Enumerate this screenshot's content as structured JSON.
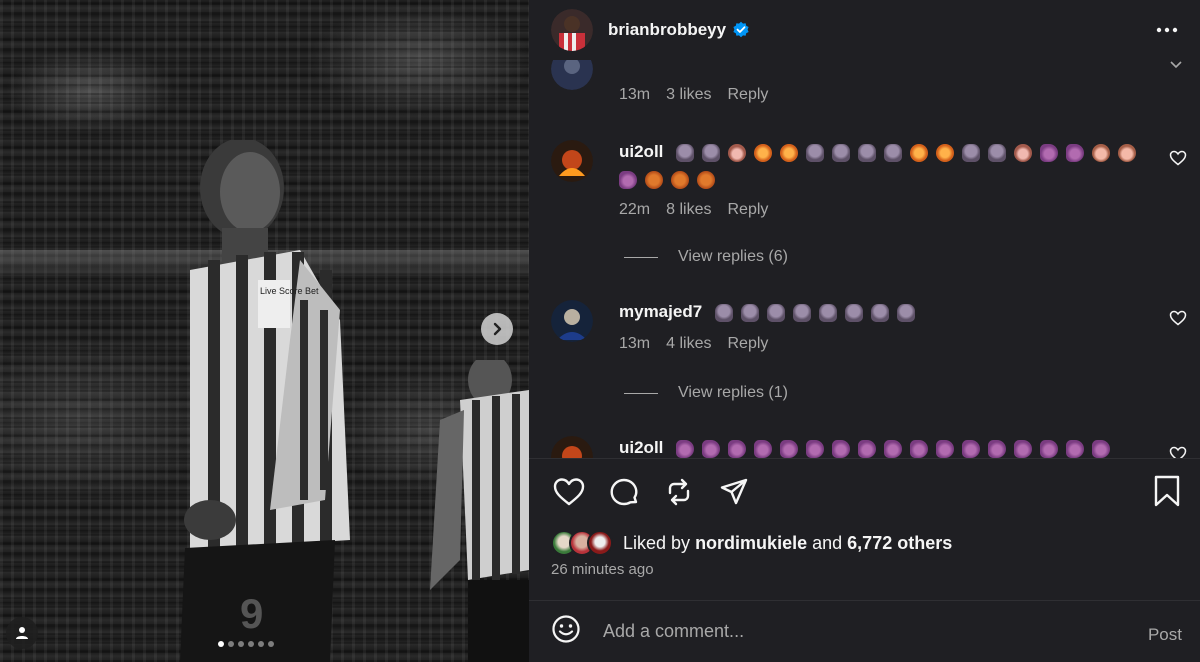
{
  "post": {
    "username": "brianbrobbeyy",
    "more_icon": "more-horizontal-icon",
    "verified_icon": "verified-badge-icon"
  },
  "media": {
    "carousel_dots": 6,
    "active_dot": 0,
    "jersey_number": "9",
    "sponsor_text": "Live Score Bet"
  },
  "comments": [
    {
      "username": "",
      "text": "",
      "time": "13m",
      "likes": "3 likes",
      "reply_label": "Reply"
    },
    {
      "username": "ui2oll",
      "emoji_sequence": [
        "gorilla",
        "gorilla",
        "monkey",
        "orangutan",
        "orangutan",
        "gorilla",
        "gorilla",
        "gorilla",
        "gorilla",
        "orangutan",
        "orangutan",
        "gorilla",
        "gorilla",
        "monkey",
        "chimp",
        "chimp",
        "face",
        "face",
        "chimp",
        "orangutan",
        "orangutan",
        "orangutan"
      ],
      "time": "22m",
      "likes": "8 likes",
      "reply_label": "Reply",
      "view_replies": "View replies (6)"
    },
    {
      "username": "mymajed7",
      "emoji_sequence": [
        "gorilla",
        "gorilla",
        "gorilla",
        "gorilla",
        "gorilla",
        "gorilla",
        "gorilla",
        "gorilla"
      ],
      "time": "13m",
      "likes": "4 likes",
      "reply_label": "Reply",
      "view_replies": "View replies (1)"
    },
    {
      "username": "ui2oll",
      "emoji_sequence": [
        "chimp",
        "chimp",
        "chimp",
        "chimp",
        "chimp",
        "chimp",
        "chimp",
        "chimp",
        "chimp",
        "chimp",
        "chimp",
        "chimp",
        "chimp",
        "chimp",
        "chimp",
        "chimp",
        "chimp",
        "chimp"
      ]
    }
  ],
  "liked_by": {
    "prefix": "Liked by",
    "user": "nordimukiele",
    "joiner": "and",
    "others": "6,772 others"
  },
  "time_ago": "26 minutes ago",
  "composer": {
    "placeholder": "Add a comment...",
    "post_label": "Post"
  }
}
